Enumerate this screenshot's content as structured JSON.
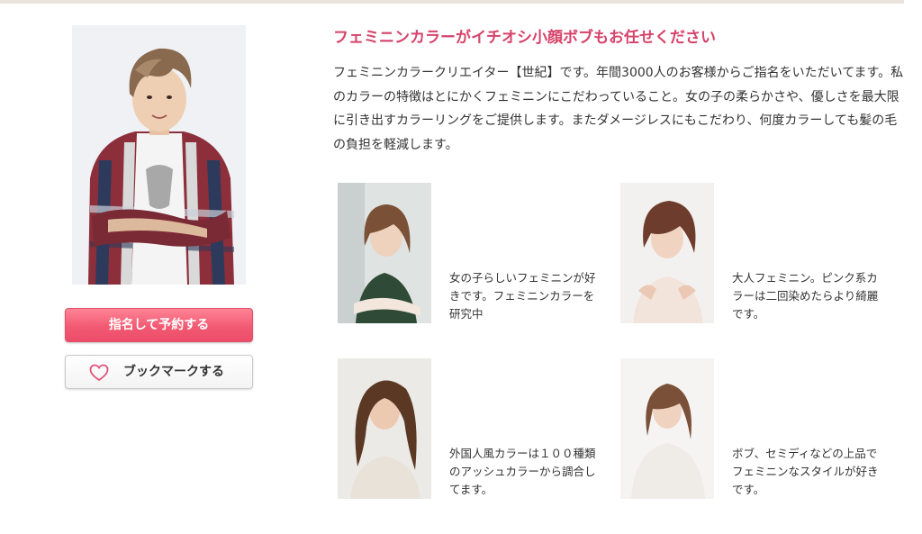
{
  "stylist": {
    "catch_title": "フェミニンカラーがイチオシ小顔ボブもお任せください",
    "intro": "フェミニンカラークリエイター【世紀】です。年間3000人のお客様からご指名をいただいてます。私のカラーの特徴はとにかくフェミニンにこだわっていること。女の子の柔らかさや、優しさを最大限に引き出すカラーリングをご提供します。またダメージレスにもこだわり、何度カラーしても髪の毛の負担を軽減します。"
  },
  "actions": {
    "reserve_label": "指名して予約する",
    "bookmark_label": "ブックマークする"
  },
  "styles": [
    {
      "caption": "女の子らしいフェミニンが好きです。フェミニンカラーを研究中"
    },
    {
      "caption": "大人フェミニン。ピンク系カラーは二回染めたらより綺麗です。"
    },
    {
      "caption": "外国人風カラーは１００種類のアッシュカラーから調合してます。"
    },
    {
      "caption": "ボブ、セミディなどの上品でフェミニンなスタイルが好きです。"
    }
  ],
  "colors": {
    "accent": "#d6436a",
    "button_pink": "#f25a73",
    "text": "#333333"
  }
}
